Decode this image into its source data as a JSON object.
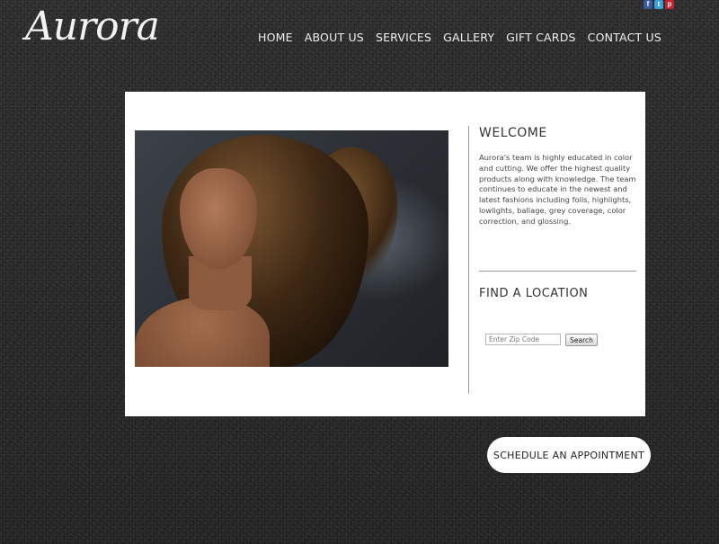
{
  "social": {
    "facebook_glyph": "f",
    "twitter_glyph": "t",
    "pinterest_glyph": "p"
  },
  "brand": {
    "logo_text": "Aurora"
  },
  "nav": {
    "items": [
      "HOME",
      "ABOUT US",
      "SERVICES",
      "GALLERY",
      "GIFT CARDS",
      "CONTACT US"
    ]
  },
  "welcome": {
    "title": "WELCOME",
    "body": "Aurora's team is highly educated in color and cutting. We offer the highest quality products along with knowledge. The team continues to educate in the newest and latest fashions including foils, highlights, lowlights, ballage, grey coverage, color correction, and glossing."
  },
  "location": {
    "title": "FIND A LOCATION",
    "zip_placeholder": "Enter Zip Code",
    "zip_value": "",
    "search_label": "Search"
  },
  "cta": {
    "label": "SCHEDULE AN APPOINTMENT"
  },
  "colors": {
    "background": "#2a2a2a",
    "panel": "#ffffff",
    "text": "#333333",
    "facebook": "#3b5998",
    "twitter": "#3aa0d8",
    "pinterest": "#c8232c"
  }
}
